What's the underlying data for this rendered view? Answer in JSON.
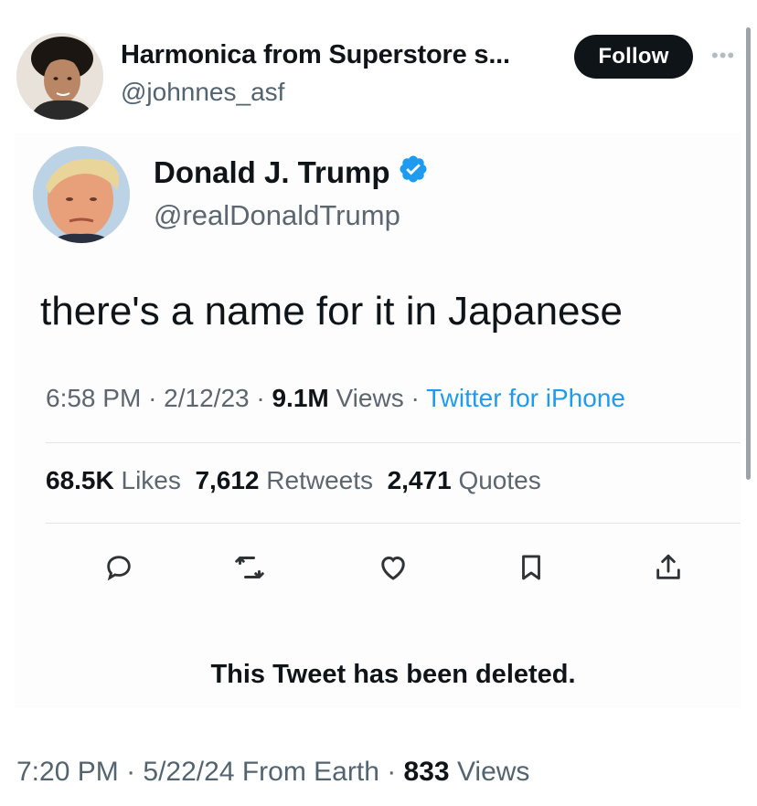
{
  "outer_tweet": {
    "author_name": "Harmonica from Superstore s...",
    "author_handle": "@johnnes_asf",
    "follow_label": "Follow",
    "more_icon": "more-horizontal-icon",
    "footer": {
      "time": "7:20 PM",
      "date": "5/22/24",
      "source": "From Earth",
      "views_count": "833",
      "views_label": "Views"
    }
  },
  "quoted_screenshot": {
    "author_name": "Donald J. Trump",
    "author_handle": "@realDonaldTrump",
    "verified_icon": "verified-badge-icon",
    "text": "there's a name for it in Japanese",
    "meta": {
      "time": "6:58 PM",
      "date": "2/12/23",
      "views_count": "9.1M",
      "views_label": "Views",
      "client": "Twitter for iPhone"
    },
    "stats": {
      "likes_count": "68.5K",
      "likes_label": "Likes",
      "retweets_count": "7,612",
      "retweets_label": "Retweets",
      "quotes_count": "2,471",
      "quotes_label": "Quotes"
    },
    "actions": [
      "reply-icon",
      "retweet-icon",
      "like-icon",
      "bookmark-icon",
      "share-icon"
    ],
    "deleted_notice": "This Tweet has been deleted."
  },
  "colors": {
    "text_primary": "#0f1419",
    "text_secondary": "#536471",
    "link_blue": "#1d9bf0",
    "follow_bg": "#0f1419"
  }
}
